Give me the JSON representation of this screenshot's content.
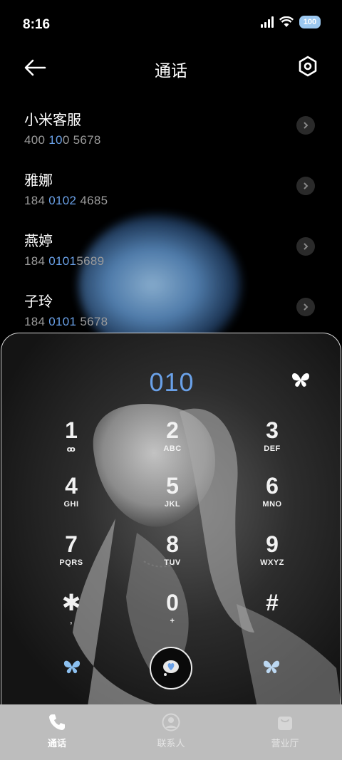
{
  "status_bar": {
    "time": "8:16",
    "battery": "100"
  },
  "header": {
    "title": "通话"
  },
  "contacts": [
    {
      "name": "小米客服",
      "num_pre": "400 ",
      "num_hl": "10",
      "num_post": "0 5678"
    },
    {
      "name": "雅娜",
      "num_pre": "184 ",
      "num_hl": "0102",
      "num_post": " 4685"
    },
    {
      "name": "燕婷",
      "num_pre": "184 ",
      "num_hl": "0101",
      "num_post": "5689"
    },
    {
      "name": "子玲",
      "num_pre": "184 ",
      "num_hl": "0101",
      "num_post": " 5678"
    }
  ],
  "dialer": {
    "number": "010",
    "keys": [
      {
        "digit": "1",
        "letters": "ꝏ"
      },
      {
        "digit": "2",
        "letters": "ABC"
      },
      {
        "digit": "3",
        "letters": "DEF"
      },
      {
        "digit": "4",
        "letters": "GHI"
      },
      {
        "digit": "5",
        "letters": "JKL"
      },
      {
        "digit": "6",
        "letters": "MNO"
      },
      {
        "digit": "7",
        "letters": "PQRS"
      },
      {
        "digit": "8",
        "letters": "TUV"
      },
      {
        "digit": "9",
        "letters": "WXYZ"
      },
      {
        "digit": "✱",
        "letters": ","
      },
      {
        "digit": "0",
        "letters": "+"
      },
      {
        "digit": "#",
        "letters": ""
      }
    ]
  },
  "tabs": [
    {
      "label": "通话",
      "icon": "phone-icon",
      "active": true
    },
    {
      "label": "联系人",
      "icon": "person-icon",
      "active": false
    },
    {
      "label": "营业厅",
      "icon": "store-icon",
      "active": false
    }
  ],
  "colors": {
    "accent": "#6aa1e8",
    "background": "#000000",
    "tabbar": "#bdbdbd"
  }
}
